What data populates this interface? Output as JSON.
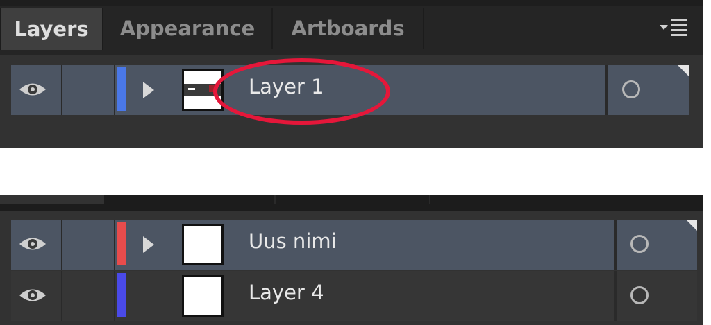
{
  "tabs": [
    {
      "label": "Layers",
      "active": true
    },
    {
      "label": "Appearance",
      "active": false
    },
    {
      "label": "Artboards",
      "active": false
    }
  ],
  "icons": {
    "panel_menu": "panel-menu-icon",
    "visibility": "eye-icon",
    "expand": "expand-triangle-icon",
    "target": "target-circle-icon"
  },
  "top_panel": {
    "layers": [
      {
        "name": "Layer 1",
        "color": "#4a78e8",
        "has_sublayers": true,
        "selected": true
      }
    ]
  },
  "bottom_panel": {
    "layers": [
      {
        "name": "Uus nimi",
        "color": "#e84c4c",
        "has_sublayers": true,
        "selected": true
      },
      {
        "name": "Layer 4",
        "color": "#4a4ae8",
        "has_sublayers": false,
        "selected": false
      }
    ]
  },
  "colors": {
    "panel_bg": "#323232",
    "selected_row": "#4c5563",
    "annotation": "#e5173a"
  }
}
